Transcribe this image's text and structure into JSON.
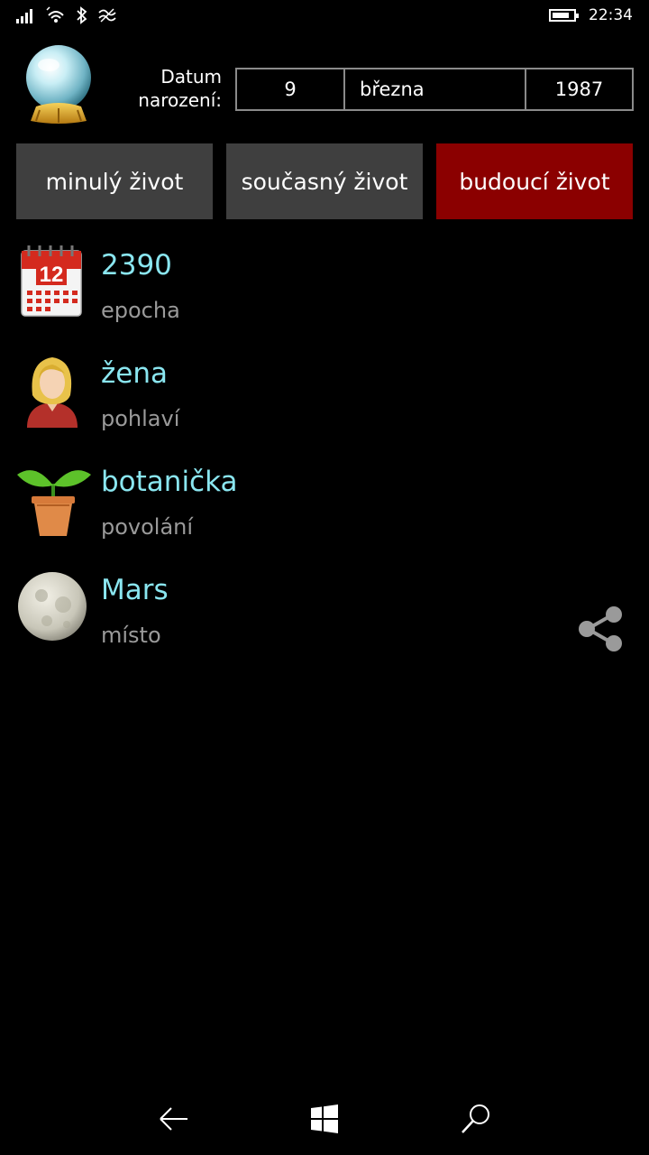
{
  "status_bar": {
    "time": "22:34",
    "icons": [
      "signal-icon",
      "wifi-icon",
      "bluetooth-icon",
      "data-icon",
      "battery-icon"
    ],
    "battery_level": 0.8
  },
  "header": {
    "logo_icon": "crystal-ball-icon",
    "dob_label": "Datum narození:",
    "day": "9",
    "month": "března",
    "year": "1987"
  },
  "tabs": [
    {
      "label": "minulý život",
      "active": false
    },
    {
      "label": "současný život",
      "active": false
    },
    {
      "label": "budoucí život",
      "active": true
    }
  ],
  "items": [
    {
      "icon": "calendar-icon",
      "value": "2390",
      "label": "epocha"
    },
    {
      "icon": "woman-icon",
      "value": "žena",
      "label": "pohlaví"
    },
    {
      "icon": "plant-icon",
      "value": "botanička",
      "label": "povolání"
    },
    {
      "icon": "moon-icon",
      "value": "Mars",
      "label": "místo"
    }
  ],
  "share_icon": "share-icon",
  "navbar": [
    "back-icon",
    "windows-icon",
    "search-icon"
  ],
  "colors": {
    "background": "#000000",
    "tab": "#3f3f3f",
    "tab_active": "#8b0000",
    "value": "#8ae6f0",
    "label": "#9a9a9a"
  }
}
